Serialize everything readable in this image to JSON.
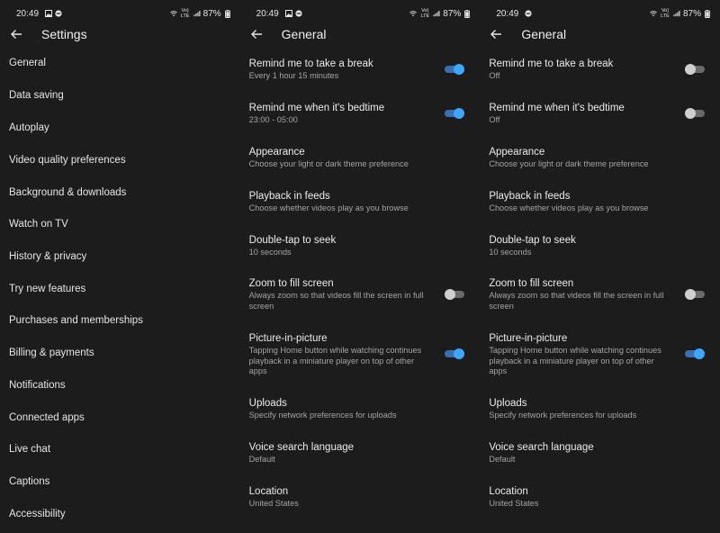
{
  "status": {
    "time": "20:49",
    "battery": "87%",
    "network": "Vo) LTE"
  },
  "panels": [
    {
      "title": "Settings",
      "items": [
        "General",
        "Data saving",
        "Autoplay",
        "Video quality preferences",
        "Background & downloads",
        "Watch on TV",
        "History & privacy",
        "Try new features",
        "Purchases and memberships",
        "Billing & payments",
        "Notifications",
        "Connected apps",
        "Live chat",
        "Captions",
        "Accessibility"
      ]
    },
    {
      "title": "General",
      "rows": [
        {
          "title": "Remind me to take a break",
          "sub": "Every 1 hour 15 minutes",
          "toggle": "on"
        },
        {
          "title": "Remind me when it's bedtime",
          "sub": "23:00 - 05:00",
          "toggle": "on"
        },
        {
          "title": "Appearance",
          "sub": "Choose your light or dark theme preference"
        },
        {
          "title": "Playback in feeds",
          "sub": "Choose whether videos play as you browse"
        },
        {
          "title": "Double-tap to seek",
          "sub": "10 seconds"
        },
        {
          "title": "Zoom to fill screen",
          "sub": "Always zoom so that videos fill the screen in full screen",
          "toggle": "off"
        },
        {
          "title": "Picture-in-picture",
          "sub": "Tapping Home button while watching continues playback in a miniature player on top of other apps",
          "toggle": "on"
        },
        {
          "title": "Uploads",
          "sub": "Specify network preferences for uploads"
        },
        {
          "title": "Voice search language",
          "sub": "Default"
        },
        {
          "title": "Location",
          "sub": "United States"
        }
      ]
    },
    {
      "title": "General",
      "rows": [
        {
          "title": "Remind me to take a break",
          "sub": "Off",
          "toggle": "off"
        },
        {
          "title": "Remind me when it's bedtime",
          "sub": "Off",
          "toggle": "off"
        },
        {
          "title": "Appearance",
          "sub": "Choose your light or dark theme preference"
        },
        {
          "title": "Playback in feeds",
          "sub": "Choose whether videos play as you browse"
        },
        {
          "title": "Double-tap to seek",
          "sub": "10 seconds"
        },
        {
          "title": "Zoom to fill screen",
          "sub": "Always zoom so that videos fill the screen in full screen",
          "toggle": "off"
        },
        {
          "title": "Picture-in-picture",
          "sub": "Tapping Home button while watching continues playback in a miniature player on top of other apps",
          "toggle": "on"
        },
        {
          "title": "Uploads",
          "sub": "Specify network preferences for uploads"
        },
        {
          "title": "Voice search language",
          "sub": "Default"
        },
        {
          "title": "Location",
          "sub": "United States"
        }
      ]
    }
  ],
  "icons": {
    "back": "arrow-left-icon",
    "wifi": "wifi-icon",
    "signal": "signal-icon",
    "battery": "battery-icon",
    "gallery": "gallery-icon",
    "dnd": "do-not-disturb-icon"
  },
  "colors": {
    "background": "#1c1c1c",
    "toggle_on_thumb": "#3ea6ff",
    "toggle_on_track": "#3a6fb0",
    "toggle_off_thumb": "#cfcfcf",
    "toggle_off_track": "#6a6a6a",
    "secondary_text": "#a4a4a4"
  }
}
